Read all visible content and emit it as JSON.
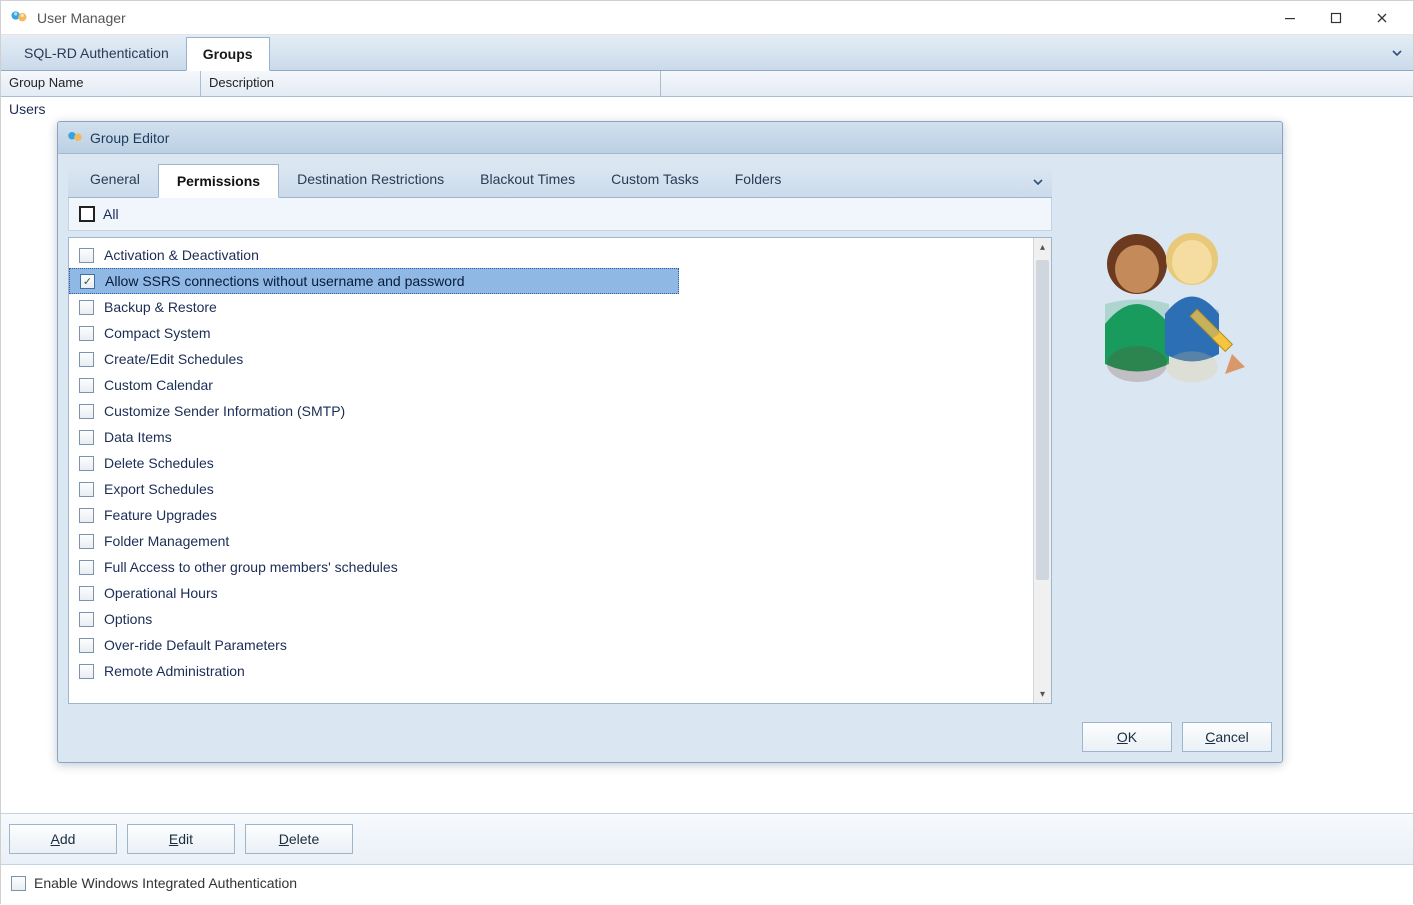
{
  "window": {
    "title": "User Manager"
  },
  "topTabs": {
    "items": [
      {
        "label": "SQL-RD Authentication",
        "active": false
      },
      {
        "label": "Groups",
        "active": true
      }
    ]
  },
  "columns": {
    "c1": "Group Name",
    "c2": "Description"
  },
  "gridRow": {
    "groupName": "Users"
  },
  "editor": {
    "title": "Group Editor",
    "tabs": [
      {
        "label": "General",
        "active": false
      },
      {
        "label": "Permissions",
        "active": true
      },
      {
        "label": "Destination Restrictions",
        "active": false
      },
      {
        "label": "Blackout Times",
        "active": false
      },
      {
        "label": "Custom Tasks",
        "active": false
      },
      {
        "label": "Folders",
        "active": false
      }
    ],
    "allLabel": "All",
    "permissions": [
      {
        "label": "Activation & Deactivation",
        "checked": false,
        "selected": false
      },
      {
        "label": "Allow SSRS connections without username and password",
        "checked": true,
        "selected": true
      },
      {
        "label": "Backup & Restore",
        "checked": false,
        "selected": false
      },
      {
        "label": "Compact System",
        "checked": false,
        "selected": false
      },
      {
        "label": "Create/Edit Schedules",
        "checked": false,
        "selected": false
      },
      {
        "label": "Custom Calendar",
        "checked": false,
        "selected": false
      },
      {
        "label": "Customize Sender Information (SMTP)",
        "checked": false,
        "selected": false
      },
      {
        "label": "Data Items",
        "checked": false,
        "selected": false
      },
      {
        "label": "Delete Schedules",
        "checked": false,
        "selected": false
      },
      {
        "label": "Export Schedules",
        "checked": false,
        "selected": false
      },
      {
        "label": "Feature Upgrades",
        "checked": false,
        "selected": false
      },
      {
        "label": "Folder Management",
        "checked": false,
        "selected": false
      },
      {
        "label": "Full Access to other group members' schedules",
        "checked": false,
        "selected": false
      },
      {
        "label": "Operational Hours",
        "checked": false,
        "selected": false
      },
      {
        "label": "Options",
        "checked": false,
        "selected": false
      },
      {
        "label": "Over-ride Default Parameters",
        "checked": false,
        "selected": false
      },
      {
        "label": "Remote Administration",
        "checked": false,
        "selected": false
      }
    ],
    "buttons": {
      "ok": "OK",
      "cancel": "Cancel"
    }
  },
  "footer": {
    "add": "Add",
    "edit": "Edit",
    "delete": "Delete"
  },
  "integratedAuth": {
    "label": "Enable Windows Integrated Authentication",
    "checked": false
  }
}
